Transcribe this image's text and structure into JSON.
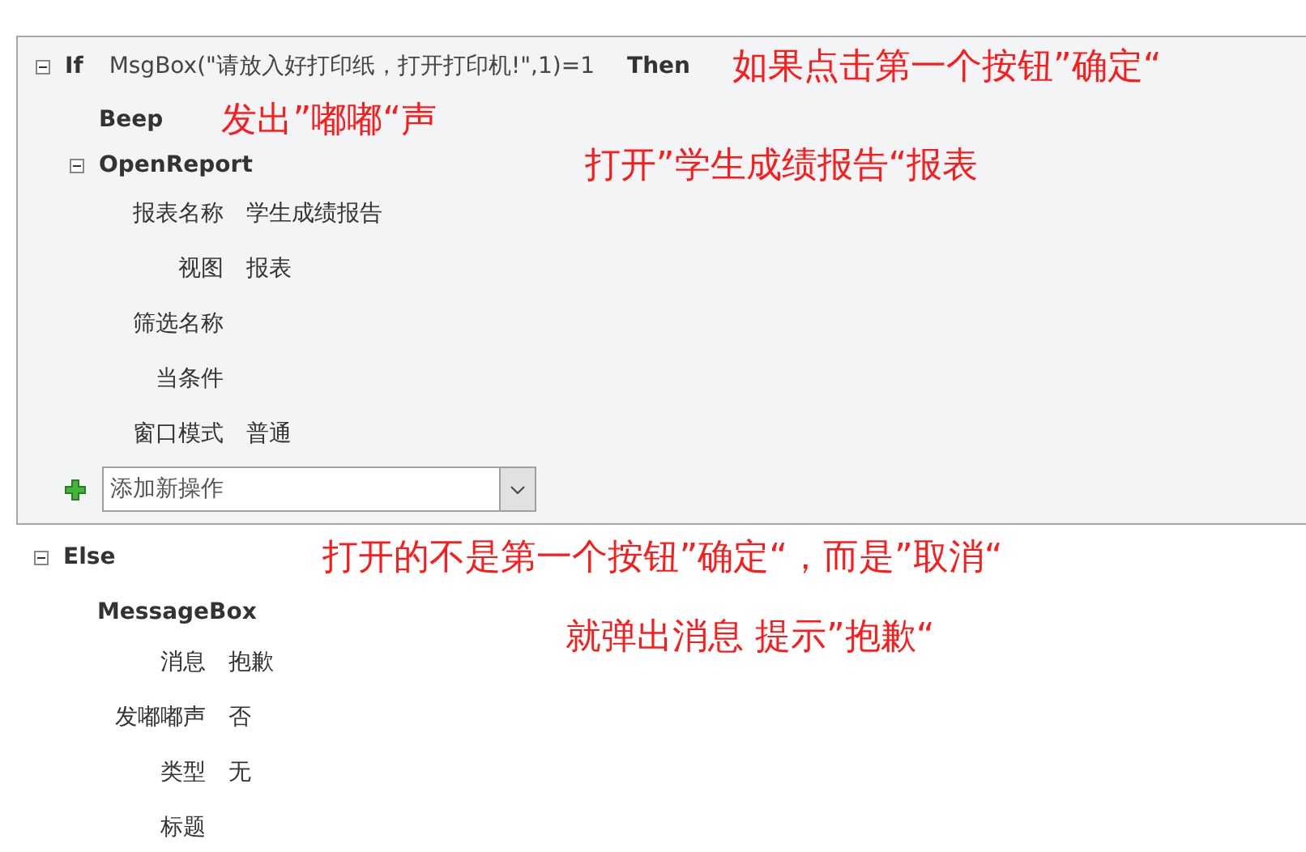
{
  "if_block": {
    "expanded": true,
    "keyword": "If",
    "condition": "MsgBox(\"请放入好打印纸，打开打印机!\",1)=1",
    "then_keyword": "Then",
    "note": "如果点击第一个按钮”确定“",
    "actions": [
      {
        "kind": "simple",
        "name": "Beep",
        "note": "发出”嘟嘟“声"
      },
      {
        "kind": "expandable",
        "name": "OpenReport",
        "expanded": true,
        "note": "打开”学生成绩报告“报表",
        "arguments": [
          {
            "label": "报表名称",
            "value": "学生成绩报告"
          },
          {
            "label": "视图",
            "value": "报表"
          },
          {
            "label": "筛选名称"
          },
          {
            "label": "当条件"
          },
          {
            "label": "窗口模式",
            "value": "普通"
          }
        ]
      }
    ],
    "add_action": {
      "placeholder": "添加新操作"
    }
  },
  "else_block": {
    "expanded": true,
    "keyword": "Else",
    "note": "打开的不是第一个按钮”确定“，而是”取消“",
    "actions": [
      {
        "kind": "with_arguments",
        "name": "MessageBox",
        "arguments": [
          {
            "label": "消息",
            "value": "抱歉"
          },
          {
            "label": "发嘟嘟声",
            "value": "否"
          },
          {
            "label": "类型",
            "value": "无"
          },
          {
            "label": "标题"
          }
        ]
      }
    ],
    "floating_note": "就弹出消息 提示”抱歉“"
  }
}
